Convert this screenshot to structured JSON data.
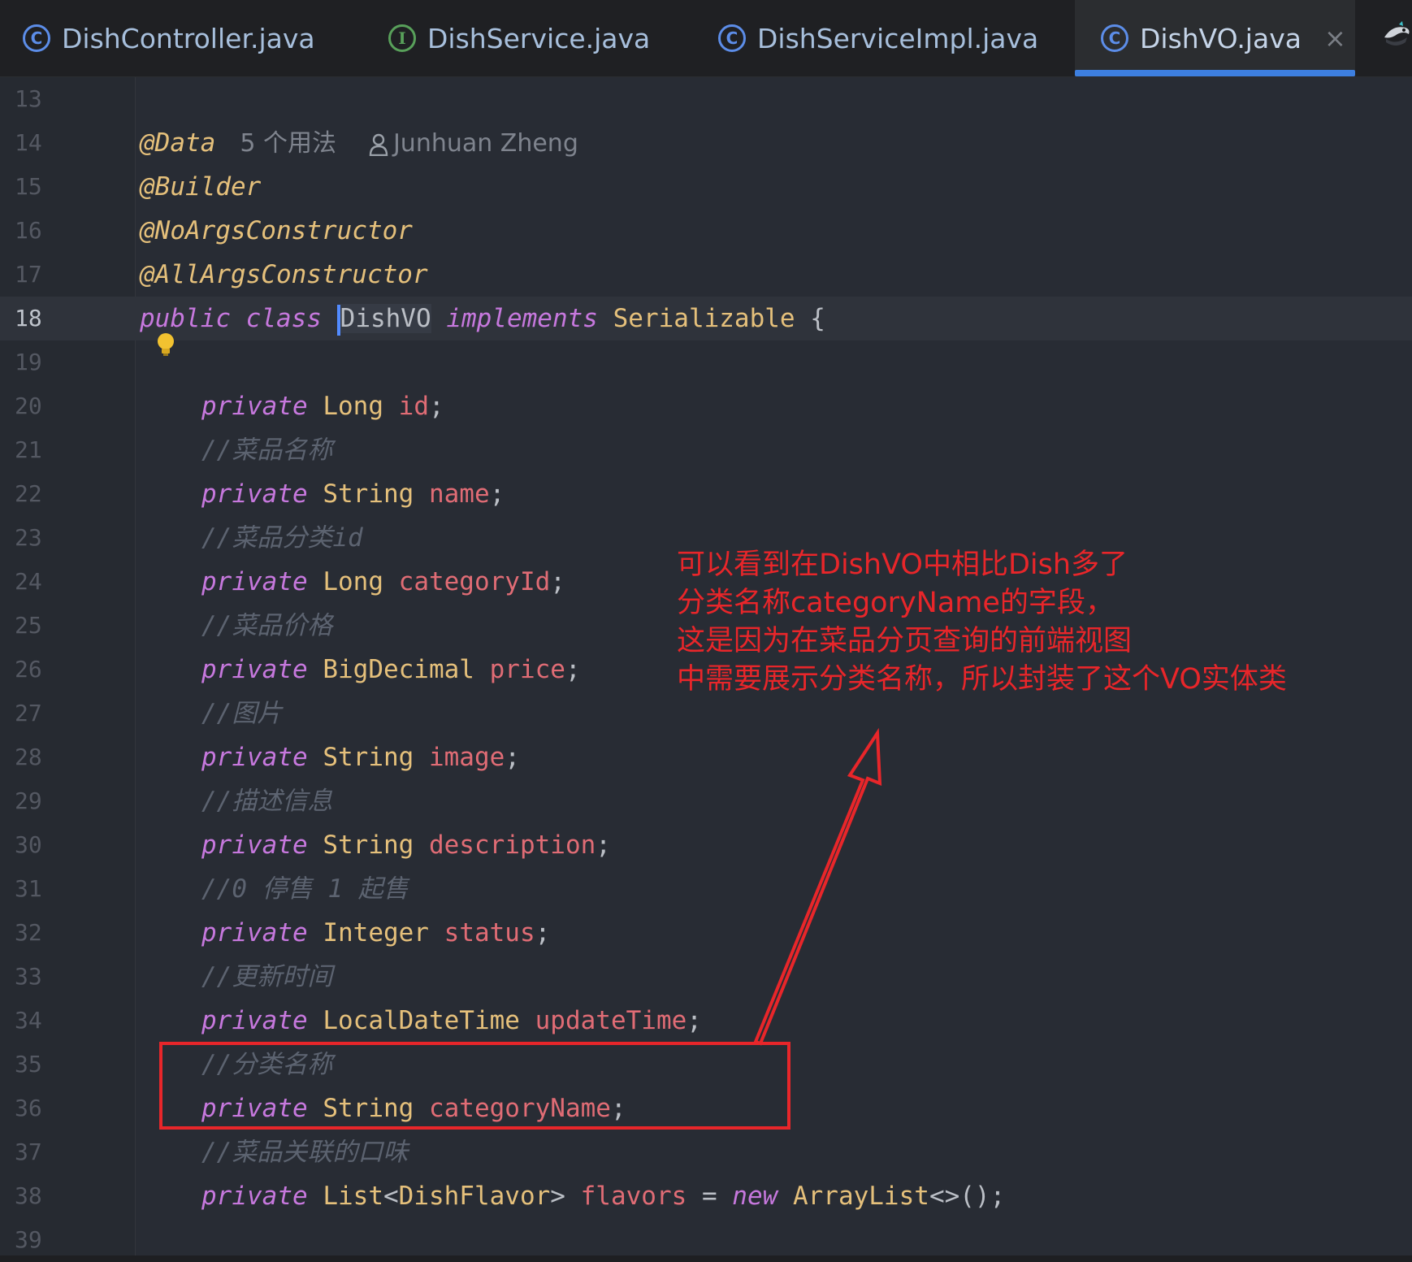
{
  "tabs": [
    {
      "label": "DishController.java",
      "icon": "C",
      "kind": "class"
    },
    {
      "label": "DishService.java",
      "icon": "I",
      "kind": "interface"
    },
    {
      "label": "DishServiceImpl.java",
      "icon": "C",
      "kind": "class"
    },
    {
      "label": "DishVO.java",
      "icon": "C",
      "kind": "class",
      "active": true
    }
  ],
  "tab_close_glyph": "×",
  "editor": {
    "lines": [
      {
        "n": "13"
      },
      {
        "n": "14",
        "tokens": [
          [
            "ann",
            "@Data"
          ]
        ],
        "inlay_usages": "5 个用法",
        "inlay_author": "Junhuan Zheng"
      },
      {
        "n": "15",
        "tokens": [
          [
            "ann",
            "@Builder"
          ]
        ]
      },
      {
        "n": "16",
        "tokens": [
          [
            "ann",
            "@NoArgsConstructor"
          ]
        ]
      },
      {
        "n": "17",
        "tokens": [
          [
            "ann",
            "@AllArgsConstructor"
          ]
        ]
      },
      {
        "n": "18",
        "current": true,
        "tokens": [
          [
            "kw",
            "public"
          ],
          [
            "punc",
            " "
          ],
          [
            "kw",
            "class"
          ],
          [
            "punc",
            " "
          ],
          [
            "caret",
            ""
          ],
          [
            "cls",
            "DishVO"
          ],
          [
            "punc",
            " "
          ],
          [
            "kw",
            "implements"
          ],
          [
            "punc",
            " "
          ],
          [
            "typ",
            "Serializable"
          ],
          [
            "punc",
            " {"
          ]
        ]
      },
      {
        "n": "19"
      },
      {
        "n": "20",
        "indent": true,
        "tokens": [
          [
            "kw",
            "private"
          ],
          [
            "punc",
            " "
          ],
          [
            "typ",
            "Long"
          ],
          [
            "punc",
            " "
          ],
          [
            "fld",
            "id"
          ],
          [
            "punc",
            ";"
          ]
        ]
      },
      {
        "n": "21",
        "indent": true,
        "tokens": [
          [
            "cmt",
            "//菜品名称"
          ]
        ]
      },
      {
        "n": "22",
        "indent": true,
        "tokens": [
          [
            "kw",
            "private"
          ],
          [
            "punc",
            " "
          ],
          [
            "typ",
            "String"
          ],
          [
            "punc",
            " "
          ],
          [
            "fld",
            "name"
          ],
          [
            "punc",
            ";"
          ]
        ]
      },
      {
        "n": "23",
        "indent": true,
        "tokens": [
          [
            "cmt",
            "//菜品分类id"
          ]
        ]
      },
      {
        "n": "24",
        "indent": true,
        "tokens": [
          [
            "kw",
            "private"
          ],
          [
            "punc",
            " "
          ],
          [
            "typ",
            "Long"
          ],
          [
            "punc",
            " "
          ],
          [
            "fld",
            "categoryId"
          ],
          [
            "punc",
            ";"
          ]
        ]
      },
      {
        "n": "25",
        "indent": true,
        "tokens": [
          [
            "cmt",
            "//菜品价格"
          ]
        ]
      },
      {
        "n": "26",
        "indent": true,
        "tokens": [
          [
            "kw",
            "private"
          ],
          [
            "punc",
            " "
          ],
          [
            "typ",
            "BigDecimal"
          ],
          [
            "punc",
            " "
          ],
          [
            "fld",
            "price"
          ],
          [
            "punc",
            ";"
          ]
        ]
      },
      {
        "n": "27",
        "indent": true,
        "tokens": [
          [
            "cmt",
            "//图片"
          ]
        ]
      },
      {
        "n": "28",
        "indent": true,
        "tokens": [
          [
            "kw",
            "private"
          ],
          [
            "punc",
            " "
          ],
          [
            "typ",
            "String"
          ],
          [
            "punc",
            " "
          ],
          [
            "fld",
            "image"
          ],
          [
            "punc",
            ";"
          ]
        ]
      },
      {
        "n": "29",
        "indent": true,
        "tokens": [
          [
            "cmt",
            "//描述信息"
          ]
        ]
      },
      {
        "n": "30",
        "indent": true,
        "tokens": [
          [
            "kw",
            "private"
          ],
          [
            "punc",
            " "
          ],
          [
            "typ",
            "String"
          ],
          [
            "punc",
            " "
          ],
          [
            "fld",
            "description"
          ],
          [
            "punc",
            ";"
          ]
        ]
      },
      {
        "n": "31",
        "indent": true,
        "tokens": [
          [
            "cmt",
            "//0 停售 1 起售"
          ]
        ]
      },
      {
        "n": "32",
        "indent": true,
        "tokens": [
          [
            "kw",
            "private"
          ],
          [
            "punc",
            " "
          ],
          [
            "typ",
            "Integer"
          ],
          [
            "punc",
            " "
          ],
          [
            "fld",
            "status"
          ],
          [
            "punc",
            ";"
          ]
        ]
      },
      {
        "n": "33",
        "indent": true,
        "tokens": [
          [
            "cmt",
            "//更新时间"
          ]
        ]
      },
      {
        "n": "34",
        "indent": true,
        "tokens": [
          [
            "kw",
            "private"
          ],
          [
            "punc",
            " "
          ],
          [
            "typ",
            "LocalDateTime"
          ],
          [
            "punc",
            " "
          ],
          [
            "fld",
            "updateTime"
          ],
          [
            "punc",
            ";"
          ]
        ]
      },
      {
        "n": "35",
        "indent": true,
        "tokens": [
          [
            "cmt",
            "//分类名称"
          ]
        ]
      },
      {
        "n": "36",
        "indent": true,
        "tokens": [
          [
            "kw",
            "private"
          ],
          [
            "punc",
            " "
          ],
          [
            "typ",
            "String"
          ],
          [
            "punc",
            " "
          ],
          [
            "fld",
            "categoryName"
          ],
          [
            "punc",
            ";"
          ]
        ]
      },
      {
        "n": "37",
        "indent": true,
        "tokens": [
          [
            "cmt",
            "//菜品关联的口味"
          ]
        ]
      },
      {
        "n": "38",
        "indent": true,
        "tokens": [
          [
            "kw",
            "private"
          ],
          [
            "punc",
            " "
          ],
          [
            "typ",
            "List"
          ],
          [
            "punc",
            "<"
          ],
          [
            "typ",
            "DishFlavor"
          ],
          [
            "punc",
            "> "
          ],
          [
            "fld",
            "flavors"
          ],
          [
            "punc",
            " = "
          ],
          [
            "kw",
            "new"
          ],
          [
            "punc",
            " "
          ],
          [
            "typ",
            "ArrayList"
          ],
          [
            "punc",
            "<>();"
          ]
        ]
      },
      {
        "n": "39"
      }
    ]
  },
  "annotation": {
    "lines": [
      "可以看到在DishVO中相比Dish多了",
      "分类名称categoryName的字段，",
      "这是因为在菜品分页查询的前端视图",
      "中需要展示分类名称，所以封装了这个VO实体类"
    ],
    "color": "#e8262a"
  },
  "colors": {
    "keyword": "#c678dd",
    "type": "#e5c07b",
    "field": "#e06c75",
    "comment": "#5c6370",
    "accent": "#3d7fe0"
  }
}
